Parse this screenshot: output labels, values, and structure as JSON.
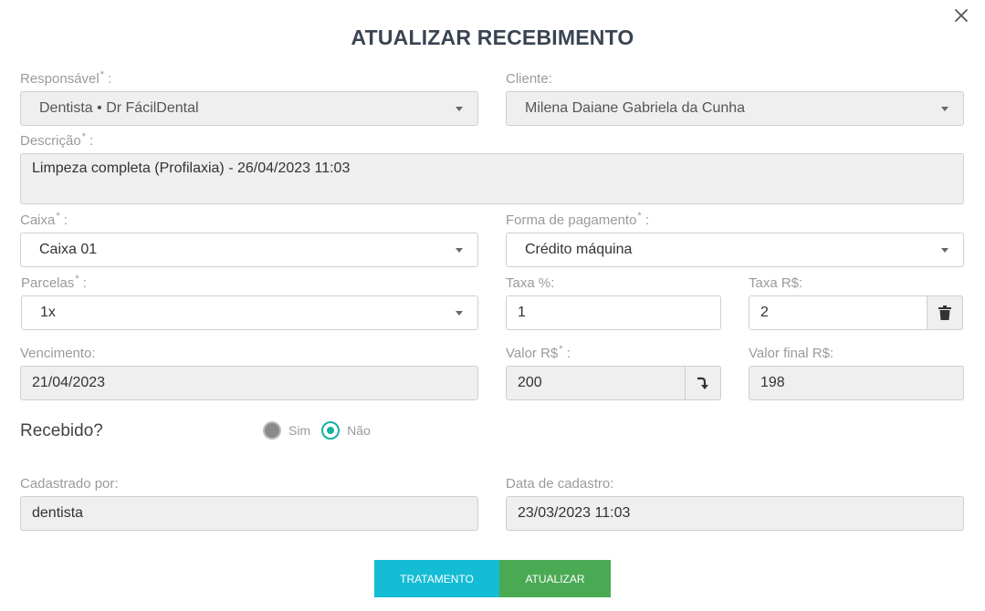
{
  "dialog": {
    "title": "ATUALIZAR RECEBIMENTO"
  },
  "responsavel": {
    "label": "Responsável",
    "required_mark": "*",
    "value": "Dentista • Dr FácilDental"
  },
  "cliente": {
    "label": "Cliente:",
    "value": "Milena Daiane Gabriela da Cunha"
  },
  "descricao": {
    "label": "Descrição",
    "required_mark": "*",
    "value": "Limpeza completa (Profilaxia) - 26/04/2023 11:03"
  },
  "caixa": {
    "label": "Caixa",
    "required_mark": "*",
    "value": "Caixa 01"
  },
  "forma_pagamento": {
    "label": "Forma de pagamento",
    "required_mark": "*",
    "value": "Crédito máquina"
  },
  "parcelas": {
    "label": "Parcelas",
    "required_mark": "*",
    "value": "1x"
  },
  "taxa_percent": {
    "label": "Taxa %:",
    "value": "1"
  },
  "taxa_rs": {
    "label": "Taxa R$:",
    "value": "2"
  },
  "vencimento": {
    "label": "Vencimento:",
    "value": "21/04/2023"
  },
  "valor": {
    "label": "Valor R$",
    "required_mark": "*",
    "value": "200"
  },
  "valor_final": {
    "label": "Valor final R$:",
    "value": "198"
  },
  "recebido": {
    "label": "Recebido?",
    "options": [
      "Sim",
      "Não"
    ],
    "selected": "Não"
  },
  "cadastrado_por": {
    "label": "Cadastrado por:",
    "value": "dentista"
  },
  "data_cadastro": {
    "label": "Data de cadastro:",
    "value": "23/03/2023 11:03"
  },
  "buttons": {
    "tratamento": "TRATAMENTO",
    "atualizar": "ATUALIZAR"
  },
  "colors": {
    "accent_teal": "#16b2a2",
    "btn_cyan": "#14bcd5",
    "btn_green": "#4aaa54"
  },
  "icons": {
    "close": "close-icon",
    "caret": "chevron-down-icon",
    "trash": "trash-icon",
    "convert": "arrow-down-turn-icon"
  }
}
